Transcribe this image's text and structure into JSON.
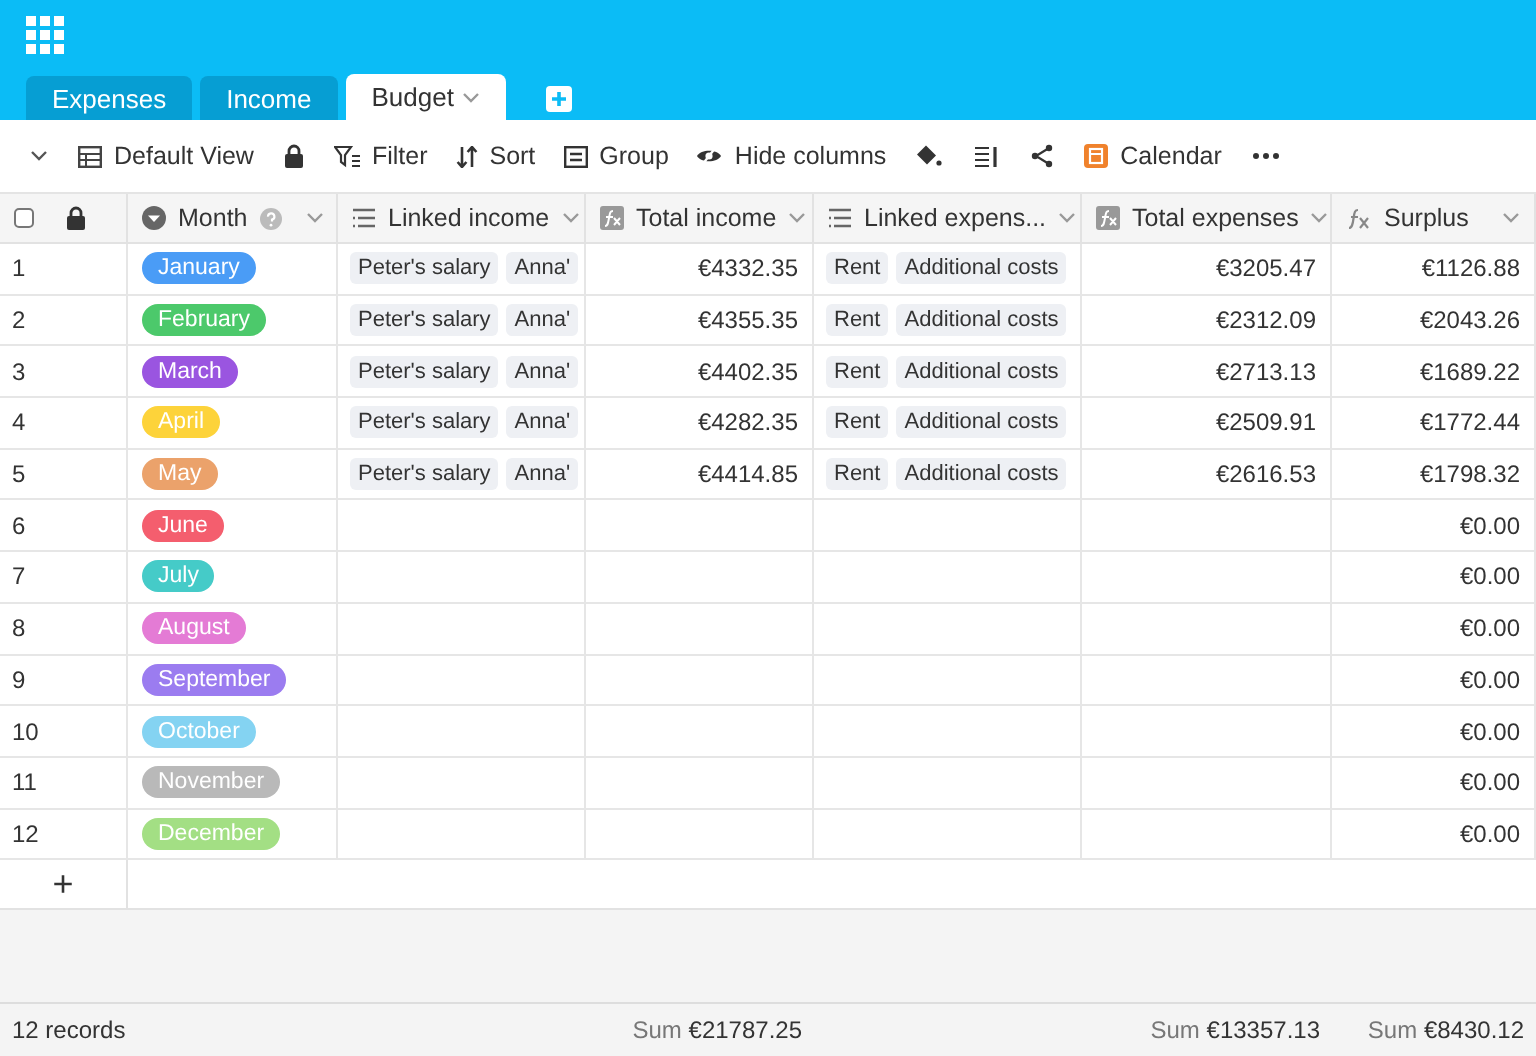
{
  "tabs": [
    {
      "label": "Expenses",
      "selected": false
    },
    {
      "label": "Income",
      "selected": false
    },
    {
      "label": "Budget",
      "selected": true
    }
  ],
  "toolbar": [
    {
      "kind": "collapse"
    },
    {
      "kind": "view",
      "label": "Default View"
    },
    {
      "kind": "lock"
    },
    {
      "kind": "filter",
      "label": "Filter"
    },
    {
      "kind": "sort",
      "label": "Sort"
    },
    {
      "kind": "group",
      "label": "Group"
    },
    {
      "kind": "hide",
      "label": "Hide columns"
    },
    {
      "kind": "paint"
    },
    {
      "kind": "height"
    },
    {
      "kind": "share"
    },
    {
      "kind": "calendar",
      "label": "Calendar"
    },
    {
      "kind": "more"
    }
  ],
  "columns": [
    {
      "kind": "select",
      "label": "Month",
      "help": true
    },
    {
      "kind": "link",
      "label": "Linked income"
    },
    {
      "kind": "formula",
      "label": "Total income",
      "sum": {
        "label": "Sum",
        "value": "€21787.25"
      }
    },
    {
      "kind": "link",
      "label": "Linked expens..."
    },
    {
      "kind": "formula",
      "label": "Total expenses",
      "sum": {
        "label": "Sum",
        "value": "€13357.13"
      }
    },
    {
      "kind": "fx",
      "label": "Surplus",
      "sum": {
        "label": "Sum",
        "value": "€8430.12"
      }
    }
  ],
  "rows": [
    {
      "number": "1",
      "month": {
        "label": "January",
        "color": "#4a9cf6"
      },
      "linked_income": [
        "Peter's salary",
        "Anna'"
      ],
      "total_income": "€4332.35",
      "linked_expenses": [
        "Rent",
        "Additional costs"
      ],
      "total_expenses": "€3205.47",
      "surplus": "€1126.88"
    },
    {
      "number": "2",
      "month": {
        "label": "February",
        "color": "#4cc96b"
      },
      "linked_income": [
        "Peter's salary",
        "Anna'"
      ],
      "total_income": "€4355.35",
      "linked_expenses": [
        "Rent",
        "Additional costs"
      ],
      "total_expenses": "€2312.09",
      "surplus": "€2043.26"
    },
    {
      "number": "3",
      "month": {
        "label": "March",
        "color": "#9a55e0"
      },
      "linked_income": [
        "Peter's salary",
        "Anna'"
      ],
      "total_income": "€4402.35",
      "linked_expenses": [
        "Rent",
        "Additional costs"
      ],
      "total_expenses": "€2713.13",
      "surplus": "€1689.22"
    },
    {
      "number": "4",
      "month": {
        "label": "April",
        "color": "#fdd33a"
      },
      "linked_income": [
        "Peter's salary",
        "Anna'"
      ],
      "total_income": "€4282.35",
      "linked_expenses": [
        "Rent",
        "Additional costs"
      ],
      "total_expenses": "€2509.91",
      "surplus": "€1772.44"
    },
    {
      "number": "5",
      "month": {
        "label": "May",
        "color": "#eba26b"
      },
      "linked_income": [
        "Peter's salary",
        "Anna'"
      ],
      "total_income": "€4414.85",
      "linked_expenses": [
        "Rent",
        "Additional costs"
      ],
      "total_expenses": "€2616.53",
      "surplus": "€1798.32"
    },
    {
      "number": "6",
      "month": {
        "label": "June",
        "color": "#f45e6e"
      },
      "surplus": "€0.00"
    },
    {
      "number": "7",
      "month": {
        "label": "July",
        "color": "#45cbc8"
      },
      "surplus": "€0.00"
    },
    {
      "number": "8",
      "month": {
        "label": "August",
        "color": "#e47bd5"
      },
      "surplus": "€0.00"
    },
    {
      "number": "9",
      "month": {
        "label": "September",
        "color": "#9b7cf0"
      },
      "surplus": "€0.00"
    },
    {
      "number": "10",
      "month": {
        "label": "October",
        "color": "#84d3f2"
      },
      "surplus": "€0.00"
    },
    {
      "number": "11",
      "month": {
        "label": "November",
        "color": "#b9b9b9"
      },
      "surplus": "€0.00"
    },
    {
      "number": "12",
      "month": {
        "label": "December",
        "color": "#a3df84"
      },
      "surplus": "€0.00"
    }
  ],
  "select_all": {
    "checked": false
  },
  "add_row": "+",
  "footer": {
    "records": "12 records"
  }
}
